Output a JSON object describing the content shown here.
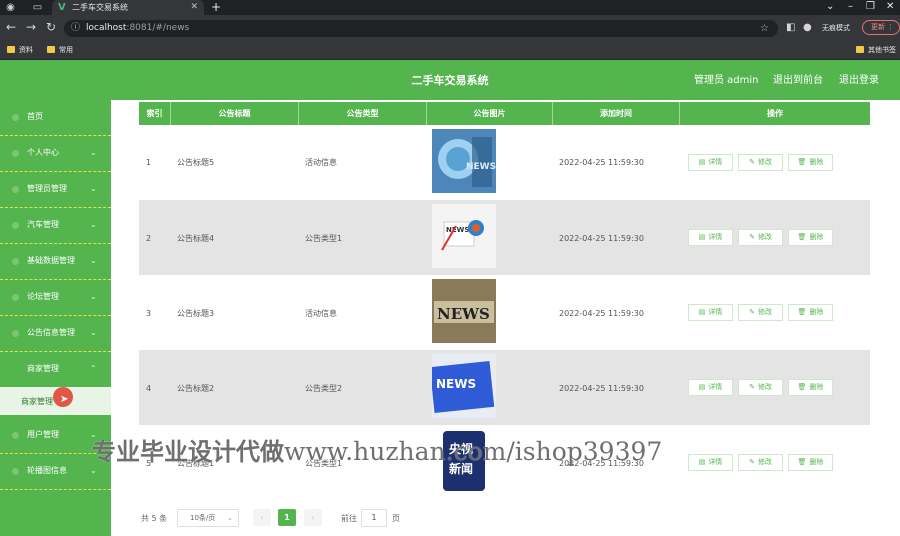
{
  "browser": {
    "tab_title": "二手车交易系统",
    "url_host": "localhost",
    "url_rest": ":8081/#/news",
    "incognito_label": "无痕模式",
    "update_label": "更新",
    "bookmarks": [
      "资料",
      "常用"
    ],
    "bookmark_right": "其他书签"
  },
  "header": {
    "title": "二手车交易系统",
    "admin_label": "管理员 admin",
    "to_front_label": "退出到前台",
    "logout_label": "退出登录"
  },
  "sidebar": {
    "items": [
      {
        "label": "首页"
      },
      {
        "label": "个人中心"
      },
      {
        "label": "管理员管理"
      },
      {
        "label": "汽车管理"
      },
      {
        "label": "基础数据管理"
      },
      {
        "label": "论坛管理"
      },
      {
        "label": "公告信息管理"
      },
      {
        "label": "商家管理"
      },
      {
        "label": "用户管理"
      },
      {
        "label": "轮播图信息"
      }
    ],
    "subitem": "商家管理"
  },
  "table": {
    "headers": [
      "索引",
      "公告标题",
      "公告类型",
      "公告图片",
      "添加时间",
      "操作"
    ],
    "rows": [
      {
        "index": "1",
        "title": "公告标题5",
        "type": "活动信息",
        "time": "2022-04-25 11:59:30"
      },
      {
        "index": "2",
        "title": "公告标题4",
        "type": "公告类型1",
        "time": "2022-04-25 11:59:30"
      },
      {
        "index": "3",
        "title": "公告标题3",
        "type": "活动信息",
        "time": "2022-04-25 11:59:30"
      },
      {
        "index": "4",
        "title": "公告标题2",
        "type": "公告类型2",
        "time": "2022-04-25 11:59:30"
      },
      {
        "index": "5",
        "title": "公告标题1",
        "type": "公告类型1",
        "time": "2022-04-25 11:59:30"
      }
    ],
    "actions": {
      "detail": "详情",
      "edit": "修改",
      "delete": "删除"
    },
    "thumb_texts": [
      "NEWS",
      "NEWS",
      "NEWS",
      "央视",
      "新闻"
    ]
  },
  "pagination": {
    "total": "共 5 条",
    "page_size": "10条/页",
    "current": "1",
    "goto_label": "前往",
    "goto_value": "1",
    "page_unit": "页"
  },
  "watermark": {
    "cn": "专业毕业设计代做",
    "en": "www.huzhan.com/ishop39397"
  },
  "colors": {
    "brand_green": "#54b54f"
  }
}
